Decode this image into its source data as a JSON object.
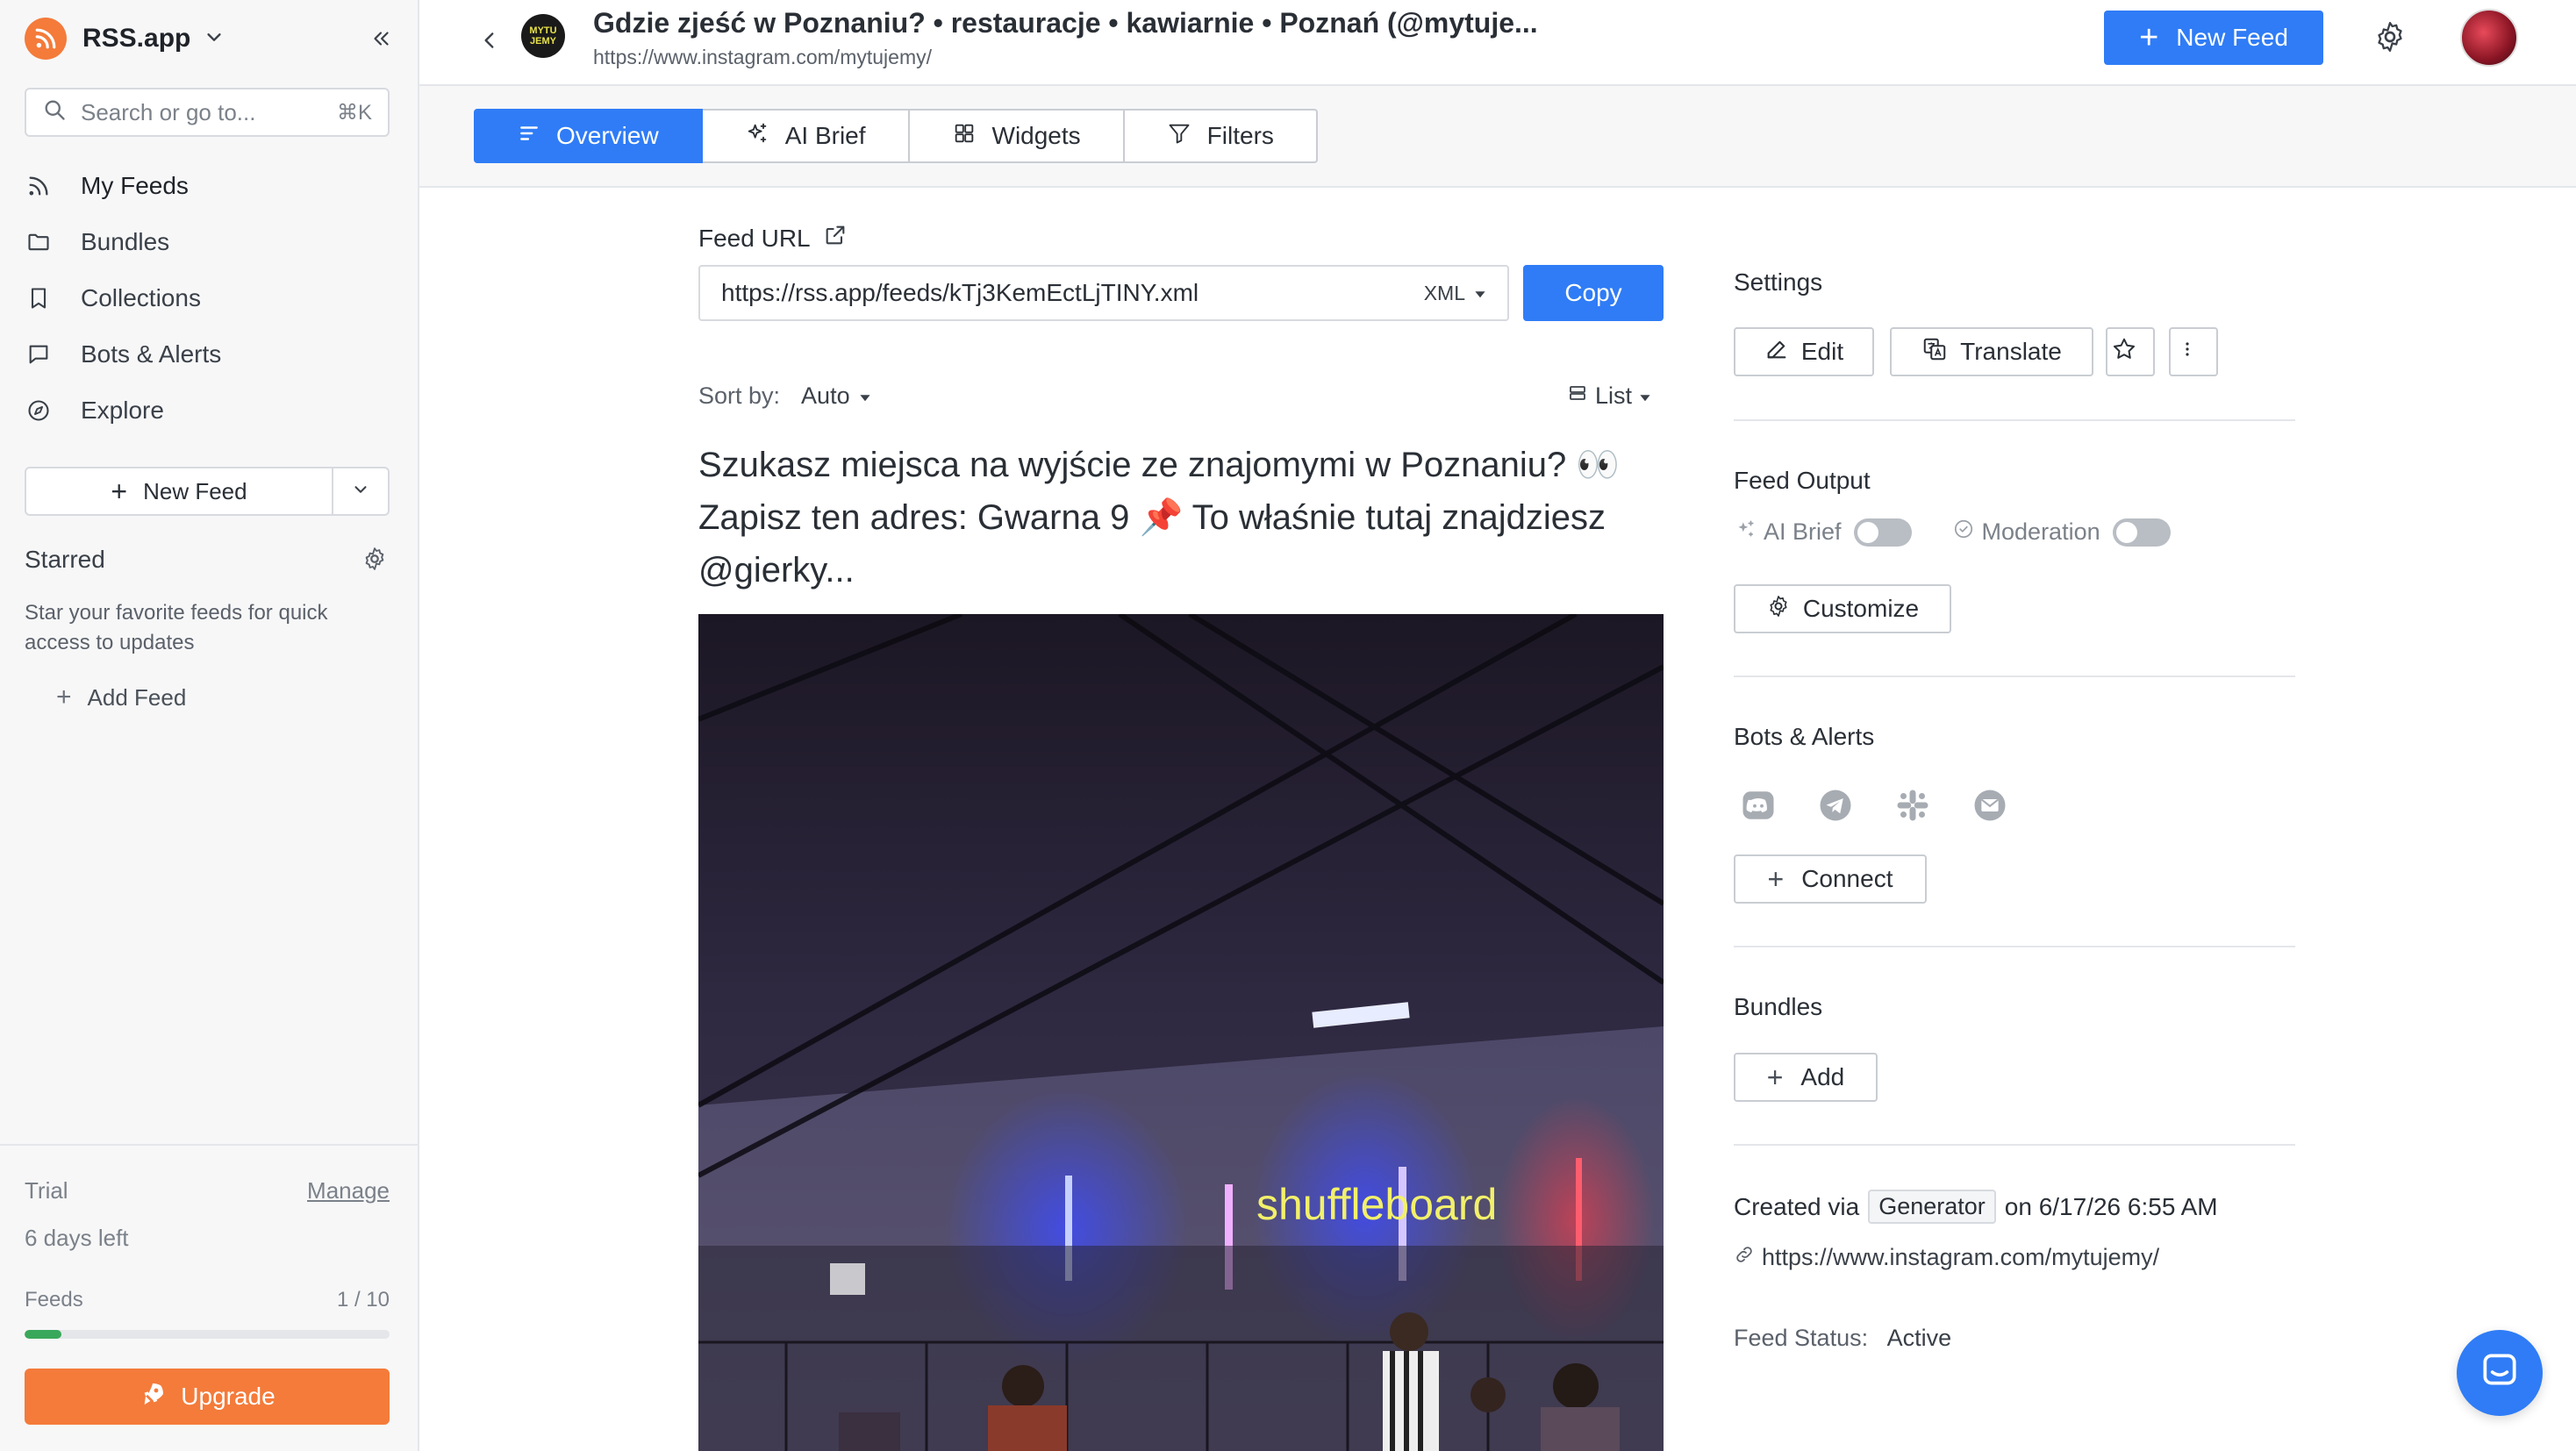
{
  "app": {
    "name": "RSS.app"
  },
  "sidebar": {
    "search": {
      "placeholder": "Search or go to...",
      "shortcut": "⌘K"
    },
    "nav": [
      {
        "label": "My Feeds",
        "icon": "rss-icon"
      },
      {
        "label": "Bundles",
        "icon": "folder-icon"
      },
      {
        "label": "Collections",
        "icon": "bookmark-icon"
      },
      {
        "label": "Bots & Alerts",
        "icon": "chat-icon"
      },
      {
        "label": "Explore",
        "icon": "compass-icon"
      }
    ],
    "new_feed_label": "New Feed",
    "starred_title": "Starred",
    "starred_desc": "Star your favorite feeds for quick access to updates",
    "add_feed_label": "Add Feed",
    "trial_label": "Trial",
    "manage_label": "Manage",
    "days_left": "6 days left",
    "feeds_label": "Feeds",
    "feeds_count": "1 / 10",
    "feeds_usage_fraction": 0.1,
    "upgrade_label": "Upgrade",
    "accent_color": "#f47b3a"
  },
  "header": {
    "title": "Gdzie zjeść w Poznaniu? • restauracje • kawiarnie • Poznań (@mytuje...",
    "subtitle": "https://www.instagram.com/mytujemy/",
    "avatar_text": "MYTU JEMY",
    "new_feed_label": "New Feed"
  },
  "tabs": [
    {
      "label": "Overview",
      "icon": "lines-icon",
      "active": true
    },
    {
      "label": "AI Brief",
      "icon": "sparkle-icon",
      "active": false
    },
    {
      "label": "Widgets",
      "icon": "grid-icon",
      "active": false
    },
    {
      "label": "Filters",
      "icon": "filter-icon",
      "active": false
    }
  ],
  "feed": {
    "url_label": "Feed URL",
    "url": "https://rss.app/feeds/kTj3KemEctLjTINY.xml",
    "format": "XML",
    "copy_label": "Copy",
    "sort_label": "Sort by:",
    "sort_value": "Auto",
    "view_mode": "List",
    "post_title": "Szukasz miejsca na wyjście ze znajomymi w Poznaniu? 👀 Zapisz ten adres: Gwarna 9 📌 To właśnie tutaj znajdziesz @gierky...",
    "image_sign_text": "shuffleboard"
  },
  "settings": {
    "title": "Settings",
    "edit_label": "Edit",
    "translate_label": "Translate",
    "output_title": "Feed Output",
    "ai_brief_label": "AI Brief",
    "ai_brief_on": false,
    "moderation_label": "Moderation",
    "moderation_on": false,
    "customize_label": "Customize",
    "bots_title": "Bots & Alerts",
    "bots_icons": [
      "discord-icon",
      "telegram-icon",
      "slack-icon",
      "email-icon"
    ],
    "connect_label": "Connect",
    "bundles_title": "Bundles",
    "add_label": "Add",
    "created_prefix": "Created via",
    "created_via": "Generator",
    "created_suffix": "on 6/17/26 6:55 AM",
    "source_url": "https://www.instagram.com/mytujemy/",
    "status_label": "Feed Status:",
    "status_value": "Active"
  },
  "colors": {
    "primary": "#2f7cf6",
    "orange": "#f47b3a",
    "progress": "#3aa85a"
  }
}
